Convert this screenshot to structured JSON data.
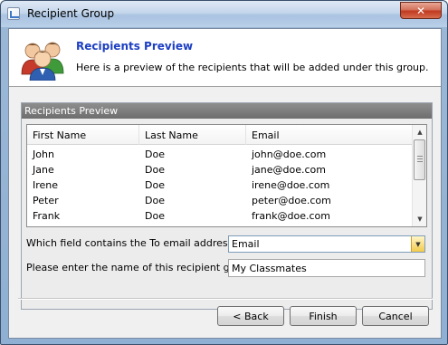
{
  "window": {
    "title": "Recipient Group",
    "close_glyph": "✕"
  },
  "header": {
    "title": "Recipients Preview",
    "subtitle": "Here is a preview of the recipients that will be added under this group.",
    "icon": "users-group-icon"
  },
  "group": {
    "title": "Recipients Preview"
  },
  "recipients": {
    "columns": [
      "First Name",
      "Last Name",
      "Email"
    ],
    "rows": [
      [
        "John",
        "Doe",
        "john@doe.com"
      ],
      [
        "Jane",
        "Doe",
        "jane@doe.com"
      ],
      [
        "Irene",
        "Doe",
        "irene@doe.com"
      ],
      [
        "Peter",
        "Doe",
        "peter@doe.com"
      ],
      [
        "Frank",
        "Doe",
        "frank@doe.com"
      ]
    ]
  },
  "form": {
    "to_field_label": "Which field contains the To email address?",
    "to_field_value": "Email",
    "group_name_label": "Please enter the name of this recipient group:",
    "group_name_value": "My Classmates"
  },
  "buttons": {
    "back": "< Back",
    "finish": "Finish",
    "cancel": "Cancel"
  },
  "colors": {
    "header_title": "#1c3fc2",
    "group_header": "#7a7a7a",
    "combo_button": "#f2c94a"
  }
}
